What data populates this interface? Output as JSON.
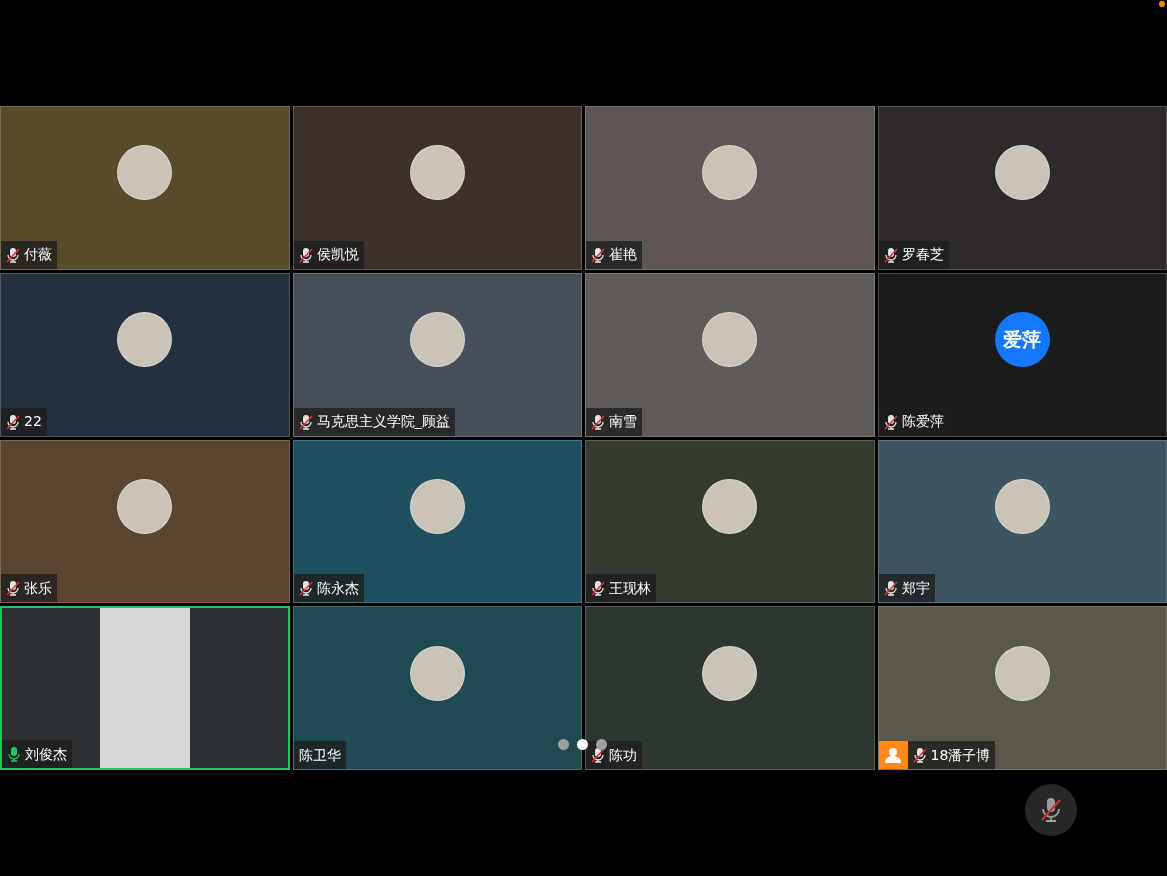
{
  "tiles": [
    {
      "name": "付薇",
      "mic_shown": true,
      "muted": true,
      "avatar": {
        "kind": "photo"
      },
      "color": "#5a4a2c",
      "speaking": false,
      "host": false
    },
    {
      "name": "侯凯悦",
      "mic_shown": true,
      "muted": true,
      "avatar": {
        "kind": "photo"
      },
      "color": "#3f302c",
      "speaking": false,
      "host": false
    },
    {
      "name": "崔艳",
      "mic_shown": true,
      "muted": true,
      "avatar": {
        "kind": "photo"
      },
      "color": "#5e5652",
      "speaking": false,
      "host": false
    },
    {
      "name": "罗春芝",
      "mic_shown": true,
      "muted": true,
      "avatar": {
        "kind": "photo"
      },
      "color": "#2e2a2a",
      "speaking": false,
      "host": false
    },
    {
      "name": "22",
      "mic_shown": true,
      "muted": true,
      "avatar": {
        "kind": "photo"
      },
      "color": "#24303d",
      "speaking": false,
      "host": false
    },
    {
      "name": "马克思主义学院_顾益",
      "mic_shown": true,
      "muted": true,
      "avatar": {
        "kind": "photo"
      },
      "color": "#47505a",
      "speaking": false,
      "host": false
    },
    {
      "name": "南雪",
      "mic_shown": true,
      "muted": true,
      "avatar": {
        "kind": "photo"
      },
      "color": "#605a58",
      "speaking": false,
      "host": false
    },
    {
      "name": "陈爱萍",
      "mic_shown": true,
      "muted": true,
      "avatar": {
        "kind": "text",
        "text": "爱萍"
      },
      "color": "#1c1c1c",
      "speaking": false,
      "host": false
    },
    {
      "name": "张乐",
      "mic_shown": true,
      "muted": true,
      "avatar": {
        "kind": "photo"
      },
      "color": "#5a4630",
      "speaking": false,
      "host": false
    },
    {
      "name": "陈永杰",
      "mic_shown": true,
      "muted": true,
      "avatar": {
        "kind": "photo"
      },
      "color": "#1f5060",
      "speaking": false,
      "host": false
    },
    {
      "name": "王现林",
      "mic_shown": true,
      "muted": true,
      "avatar": {
        "kind": "photo"
      },
      "color": "#343a30",
      "speaking": false,
      "host": false
    },
    {
      "name": "郑宇",
      "mic_shown": true,
      "muted": true,
      "avatar": {
        "kind": "photo"
      },
      "color": "#3c5560",
      "speaking": false,
      "host": false
    },
    {
      "name": "刘俊杰",
      "mic_shown": true,
      "muted": false,
      "avatar": {
        "kind": "video"
      },
      "color": "#2e3134",
      "speaking": true,
      "host": false
    },
    {
      "name": "陈卫华",
      "mic_shown": false,
      "avatar": {
        "kind": "photo"
      },
      "color": "#1f4a52",
      "speaking": false,
      "host": false
    },
    {
      "name": "陈功",
      "mic_shown": true,
      "muted": true,
      "avatar": {
        "kind": "photo"
      },
      "color": "#2e3630",
      "speaking": false,
      "host": false
    },
    {
      "name": "18潘子博",
      "mic_shown": true,
      "muted": true,
      "avatar": {
        "kind": "photo"
      },
      "color": "#5a5848",
      "speaking": false,
      "host": true
    }
  ],
  "pages": [
    {
      "selected": false
    },
    {
      "selected": true
    },
    {
      "selected": false
    }
  ],
  "mute_button": {
    "muted": true
  },
  "notification_dot": {
    "color": "#ff8a00"
  }
}
